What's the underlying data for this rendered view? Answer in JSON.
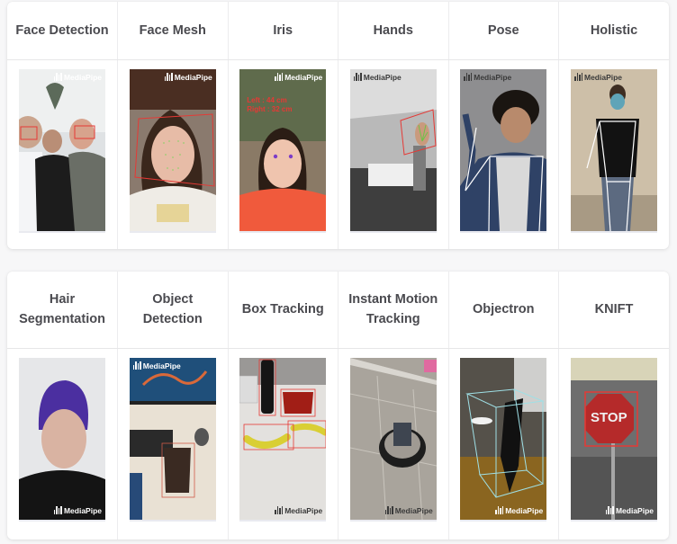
{
  "solutions_row_1": [
    {
      "title": "Face Detection",
      "image_alt": "Face Detection demo",
      "logo": "MediaPipe"
    },
    {
      "title": "Face Mesh",
      "image_alt": "Face Mesh demo",
      "logo": "MediaPipe"
    },
    {
      "title": "Iris",
      "image_alt": "Iris demo",
      "logo": "MediaPipe",
      "overlay_lines": [
        "Left : 44 cm",
        "Right : 32 cm"
      ]
    },
    {
      "title": "Hands",
      "image_alt": "Hands demo",
      "logo": "MediaPipe"
    },
    {
      "title": "Pose",
      "image_alt": "Pose demo",
      "logo": "MediaPipe"
    },
    {
      "title": "Holistic",
      "image_alt": "Holistic demo",
      "logo": "MediaPipe"
    }
  ],
  "solutions_row_2": [
    {
      "title": "Hair Segmentation",
      "image_alt": "Hair Segmentation demo",
      "logo": "MediaPipe"
    },
    {
      "title": "Object Detection",
      "image_alt": "Object Detection demo",
      "logo": "MediaPipe"
    },
    {
      "title": "Box Tracking",
      "image_alt": "Box Tracking demo",
      "logo": "MediaPipe"
    },
    {
      "title": "Instant Motion Tracking",
      "image_alt": "Instant Motion Tracking demo",
      "logo": "MediaPipe"
    },
    {
      "title": "Objectron",
      "image_alt": "Objectron demo",
      "logo": "MediaPipe"
    },
    {
      "title": "KNIFT",
      "image_alt": "KNIFT demo",
      "logo": "MediaPipe",
      "overlay_sign": "STOP"
    }
  ],
  "colors": {
    "header_text": "#4a4a4f",
    "detection_box": "#e53935",
    "card_bg": "#ffffff",
    "page_bg": "#f7f7f8"
  }
}
